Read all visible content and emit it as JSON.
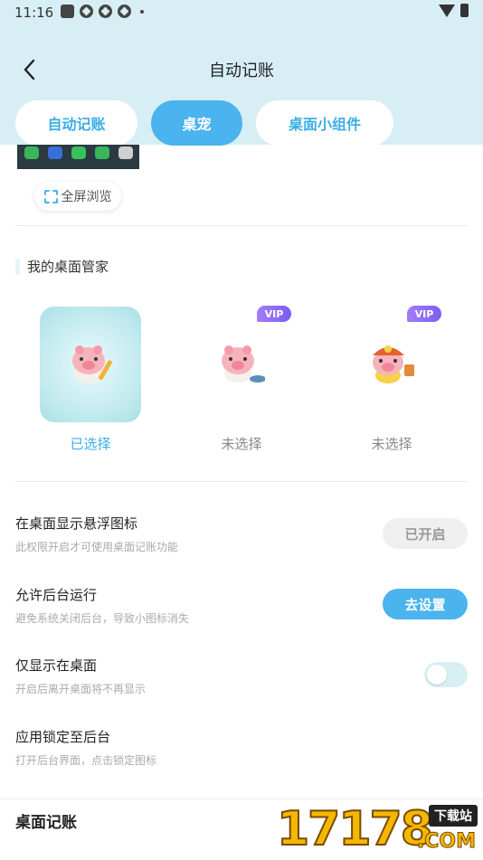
{
  "status_bar": {
    "time": "11:16"
  },
  "header": {
    "title": "自动记账"
  },
  "tabs": [
    {
      "label": "自动记账"
    },
    {
      "label": "桌宠"
    },
    {
      "label": "桌面小组件"
    }
  ],
  "preview": {
    "fullscreen_label": "全屏浏览"
  },
  "pets_section": {
    "title": "我的桌面管家",
    "pets": [
      {
        "label": "已选择",
        "selected": true,
        "vip": false
      },
      {
        "label": "未选择",
        "selected": false,
        "vip": true,
        "badge": "VIP"
      },
      {
        "label": "未选择",
        "selected": false,
        "vip": true,
        "badge": "VIP"
      }
    ]
  },
  "settings": [
    {
      "title": "在桌面显示悬浮图标",
      "subtitle": "此权限开启才可使用桌面记账功能",
      "action": "已开启"
    },
    {
      "title": "允许后台运行",
      "subtitle": "避免系统关闭后台，导致小图标消失",
      "action": "去设置"
    },
    {
      "title": "仅显示在桌面",
      "subtitle": "开启后离开桌面将不再显示",
      "toggle_on": false
    },
    {
      "title": "应用锁定至后台",
      "subtitle": "打开后台界面，点击锁定图标"
    }
  ],
  "bottom": {
    "title": "桌面记账"
  },
  "watermark": {
    "number": "17178",
    "tag": "下载站",
    "domain": ".COM"
  },
  "colors": {
    "accent": "#4bb3ee",
    "header_bg": "#d7eef4",
    "vip": "#8a66f4"
  }
}
